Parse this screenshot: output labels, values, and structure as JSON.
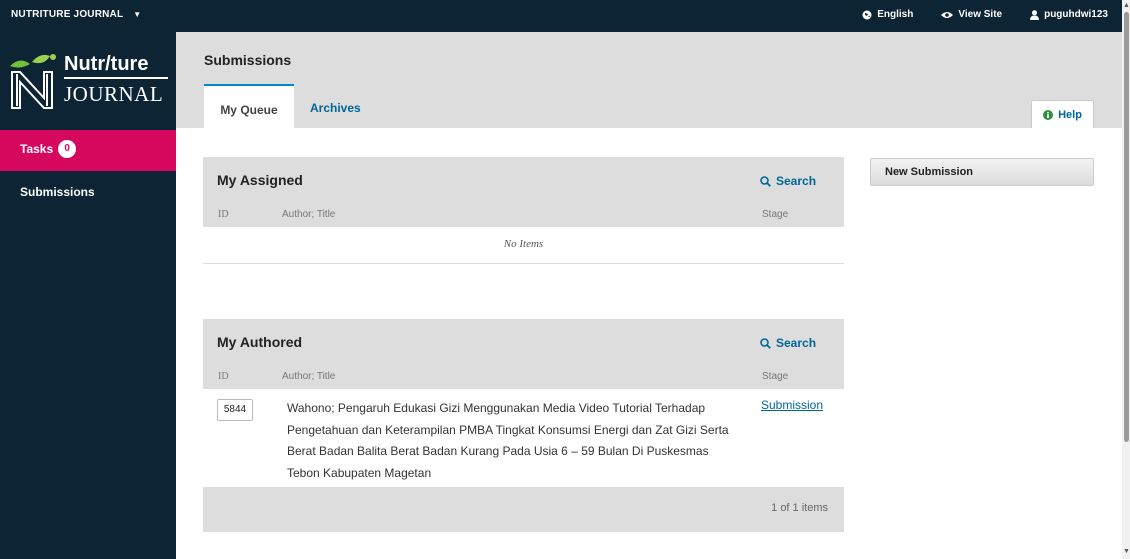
{
  "topbar": {
    "journal_name": "NUTRITURE JOURNAL",
    "language": "English",
    "view_site": "View Site",
    "username": "puguhdwi123"
  },
  "sidebar": {
    "logo_top": "Nutr/ture",
    "logo_bottom": "JOURNAL",
    "tasks_label": "Tasks",
    "tasks_count": "0",
    "submissions_label": "Submissions"
  },
  "header": {
    "title": "Submissions",
    "tabs": [
      {
        "label": "My Queue"
      },
      {
        "label": "Archives"
      }
    ],
    "help": "Help"
  },
  "assigned": {
    "title": "My Assigned",
    "search": "Search",
    "columns": {
      "id": "ID",
      "title": "Author; Title",
      "stage": "Stage"
    },
    "empty": "No Items"
  },
  "authored": {
    "title": "My Authored",
    "search": "Search",
    "columns": {
      "id": "ID",
      "title": "Author; Title",
      "stage": "Stage"
    },
    "rows": [
      {
        "id": "5844",
        "title": "Wahono; Pengaruh Edukasi Gizi Menggunakan Media Video Tutorial Terhadap Pengetahuan dan Keterampilan PMBA Tingkat Konsumsi Energi dan Zat Gizi Serta Berat Badan Balita Berat Badan Kurang Pada Usia 6 – 59 Bulan Di Puskesmas Tebon Kabupaten Magetan",
        "stage": "Submission"
      }
    ],
    "pagination": "1 of 1 items"
  },
  "actions": {
    "new_submission": "New Submission"
  },
  "colors": {
    "dark_navy": "#0c2433",
    "tasks_accent": "#d6085d",
    "link_blue": "#006798",
    "tab_indicator": "#008acb",
    "panel_gray": "#dddddd"
  },
  "icons": {
    "globe": "globe-icon",
    "eye": "eye-icon",
    "user": "user-icon",
    "search": "search-icon",
    "info": "info-icon",
    "caret": "chevron-down-icon"
  }
}
